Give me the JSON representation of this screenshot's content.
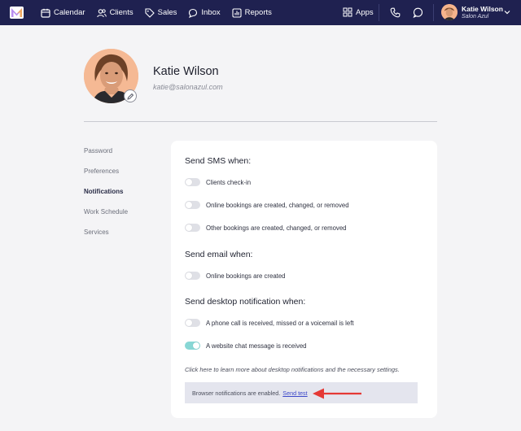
{
  "nav": {
    "items": [
      {
        "label": "Calendar",
        "icon": "calendar-icon"
      },
      {
        "label": "Clients",
        "icon": "users-icon"
      },
      {
        "label": "Sales",
        "icon": "tag-icon"
      },
      {
        "label": "Inbox",
        "icon": "chat-bubbles-icon"
      },
      {
        "label": "Reports",
        "icon": "bar-chart-icon"
      }
    ],
    "apps_label": "Apps",
    "user_name": "Katie Wilson",
    "salon": "Salon Azul",
    "bar_color": "#1f2150"
  },
  "profile": {
    "name": "Katie Wilson",
    "email": "katie@salonazul.com"
  },
  "side_menu": {
    "items": [
      "Password",
      "Preferences",
      "Notifications",
      "Work Schedule",
      "Services"
    ],
    "active": "Notifications"
  },
  "sms": {
    "heading": "Send SMS when:",
    "options": [
      {
        "label": "Clients check-in",
        "enabled": false
      },
      {
        "label": "Online bookings are created, changed, or removed",
        "enabled": false
      },
      {
        "label": "Other bookings are created, changed, or removed",
        "enabled": false
      }
    ]
  },
  "email": {
    "heading": "Send email when:",
    "options": [
      {
        "label": "Online bookings are created",
        "enabled": false
      }
    ]
  },
  "desktop": {
    "heading": "Send desktop notification when:",
    "options": [
      {
        "label": "A phone call is received, missed or a voicemail is left",
        "enabled": false
      },
      {
        "label": "A website chat message is received",
        "enabled": true
      }
    ]
  },
  "help_link": "Click here to learn more about desktop notifications and the necessary settings.",
  "notice": {
    "text": "Browser notifications are enabled.",
    "link": "Send test"
  },
  "colors": {
    "toggle_on": "#88d7d5",
    "toggle_off": "#dfe0e6",
    "annotation_arrow": "#e53935"
  }
}
